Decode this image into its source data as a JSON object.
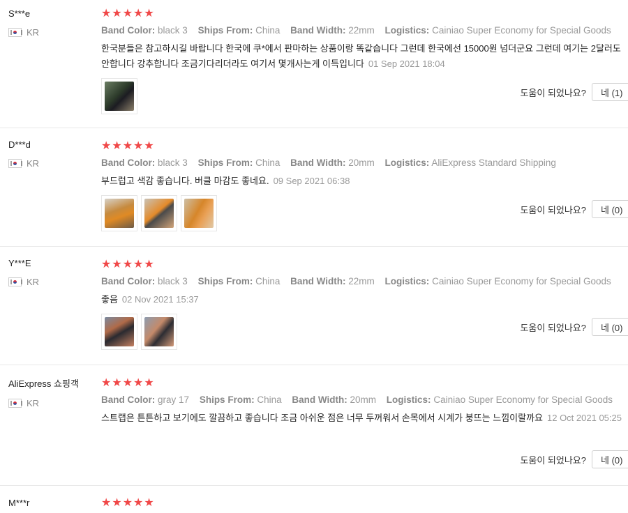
{
  "reviews": [
    {
      "user": "S***e",
      "country": "KR",
      "rating": 5,
      "attrs": [
        {
          "key": "Band Color:",
          "value": "black 3"
        },
        {
          "key": "Ships From:",
          "value": "China"
        },
        {
          "key": "Band Width:",
          "value": "22mm"
        },
        {
          "key": "Logistics:",
          "value": "Cainiao Super Economy for Special Goods"
        }
      ],
      "text": "한국분들은 참고하시길 바랍니다 한국에 쿠*에서 판마하는 상품이랑 똑같습니다 그런데 한국에선 15000원 넘더군요 그런데 여기는 2달러도 안합니다 강추합니다 조금기다리더라도 여기서 몇개사는게 이득입니다",
      "date": "01 Sep 2021 18:04",
      "photos": [
        "review-photo-watch-black-band"
      ],
      "helpful_label": "도움이 되었나요?",
      "helpful_btn": "네 (1)"
    },
    {
      "user": "D***d",
      "country": "KR",
      "rating": 5,
      "attrs": [
        {
          "key": "Band Color:",
          "value": "black 3"
        },
        {
          "key": "Ships From:",
          "value": "China"
        },
        {
          "key": "Band Width:",
          "value": "20mm"
        },
        {
          "key": "Logistics:",
          "value": "AliExpress Standard Shipping"
        }
      ],
      "text": "부드럽고 색감 좋습니다. 버클 마감도 좋네요.",
      "date": "09 Sep 2021 06:38",
      "photos": [
        "review-photo-orange-band-1",
        "review-photo-orange-band-2",
        "review-photo-orange-band-3"
      ],
      "helpful_label": "도움이 되었나요?",
      "helpful_btn": "네 (0)"
    },
    {
      "user": "Y***E",
      "country": "KR",
      "rating": 5,
      "attrs": [
        {
          "key": "Band Color:",
          "value": "black 3"
        },
        {
          "key": "Ships From:",
          "value": "China"
        },
        {
          "key": "Band Width:",
          "value": "22mm"
        },
        {
          "key": "Logistics:",
          "value": "Cainiao Super Economy for Special Goods"
        }
      ],
      "text": "좋음",
      "date": "02 Nov 2021 15:37",
      "photos": [
        "review-photo-wrist-1",
        "review-photo-wrist-2"
      ],
      "helpful_label": "도움이 되었나요?",
      "helpful_btn": "네 (0)"
    },
    {
      "user": "AliExpress 쇼핑객",
      "country": "KR",
      "rating": 5,
      "attrs": [
        {
          "key": "Band Color:",
          "value": "gray 17"
        },
        {
          "key": "Ships From:",
          "value": "China"
        },
        {
          "key": "Band Width:",
          "value": "20mm"
        },
        {
          "key": "Logistics:",
          "value": "Cainiao Super Economy for Special Goods"
        }
      ],
      "text": "스트랩은 튼튼하고 보기에도 깔끔하고 좋습니다 조금 아쉬운 점은 너무 두꺼워서 손목에서 시계가 붕뜨는 느낌이랄까요",
      "date": "12 Oct 2021 05:25",
      "photos": [],
      "helpful_label": "도움이 되었나요?",
      "helpful_btn": "네 (0)"
    },
    {
      "user": "M***r",
      "country": "",
      "rating": 5,
      "attrs": [],
      "text": "",
      "date": "",
      "photos": [],
      "helpful_label": "",
      "helpful_btn": ""
    }
  ],
  "colors": {
    "star": "#f04848",
    "muted": "#999999",
    "border": "#e8e8e8"
  }
}
